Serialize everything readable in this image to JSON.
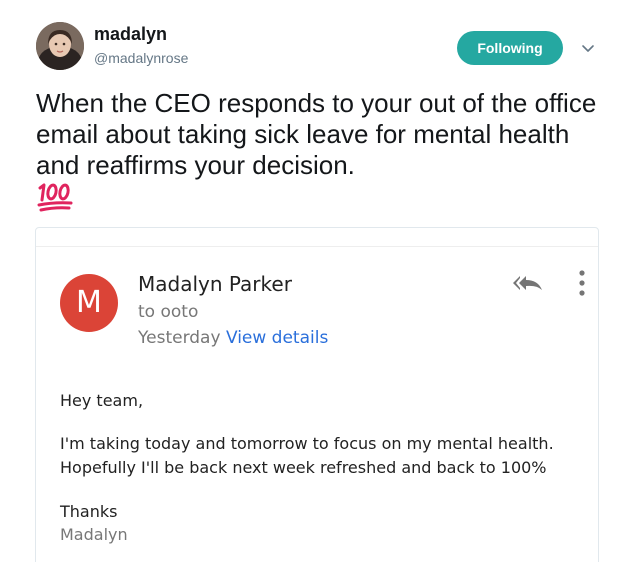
{
  "tweet": {
    "author": {
      "display_name": "madalyn",
      "handle": "@madalynrose"
    },
    "follow_button_label": "Following",
    "text": "When the CEO responds to your out of the office email about taking sick leave for mental health and reaffirms your decision.",
    "emoji": "hundred-points-emoji"
  },
  "email": {
    "sender_initial": "M",
    "sender_name": "Madalyn Parker",
    "recipient": "to ooto",
    "date": "Yesterday",
    "view_details_label": "View details",
    "body": {
      "greeting": "Hey team,",
      "line1": "I'm taking today and tomorrow to focus on my mental health.",
      "line2": "Hopefully I'll be back next week refreshed and back to 100%",
      "signoff": "Thanks",
      "signature": "Madalyn"
    }
  },
  "icons": {
    "caret": "chevron-down-icon",
    "reply_all": "reply-all-icon",
    "more": "more-vertical-icon"
  },
  "colors": {
    "follow_button": "#25a8a1",
    "sender_avatar": "#db4437",
    "link": "#2a6fdb",
    "emoji": "#e0245e"
  }
}
